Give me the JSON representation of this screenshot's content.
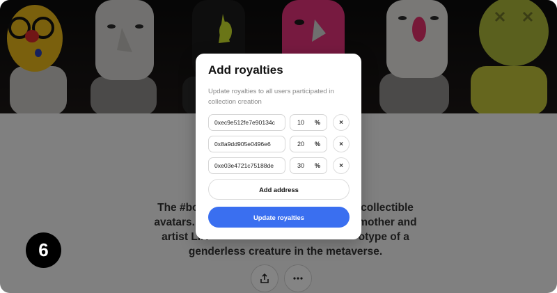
{
  "step_number": "6",
  "modal": {
    "title": "Add royalties",
    "subtitle": "Update royalties to all users participated in collection creation",
    "rows": [
      {
        "address": "0xec9e512fe7e90134c",
        "percent": "10",
        "percent_sign": "%",
        "remove": "×"
      },
      {
        "address": "0x8a9dd905e0496e6",
        "percent": "20",
        "percent_sign": "%",
        "remove": "×"
      },
      {
        "address": "0xe03e4721c75188de",
        "percent": "30",
        "percent_sign": "%",
        "remove": "×"
      }
    ],
    "add_address_label": "Add address",
    "update_label": "Update royalties"
  },
  "page": {
    "description_line1": "The #boi c                                                  collectible",
    "description_line2": "avatars. The                                               mother and",
    "description_line3": "artist LIR                                                  otype of a",
    "description_line4": "genderless creature in the metaverse."
  },
  "icons": {
    "share": "share-icon",
    "more": "more-icon",
    "remove": "close-icon"
  },
  "colors": {
    "primary": "#3a6ff0",
    "overlay": "rgba(0,0,0,0.47)"
  }
}
